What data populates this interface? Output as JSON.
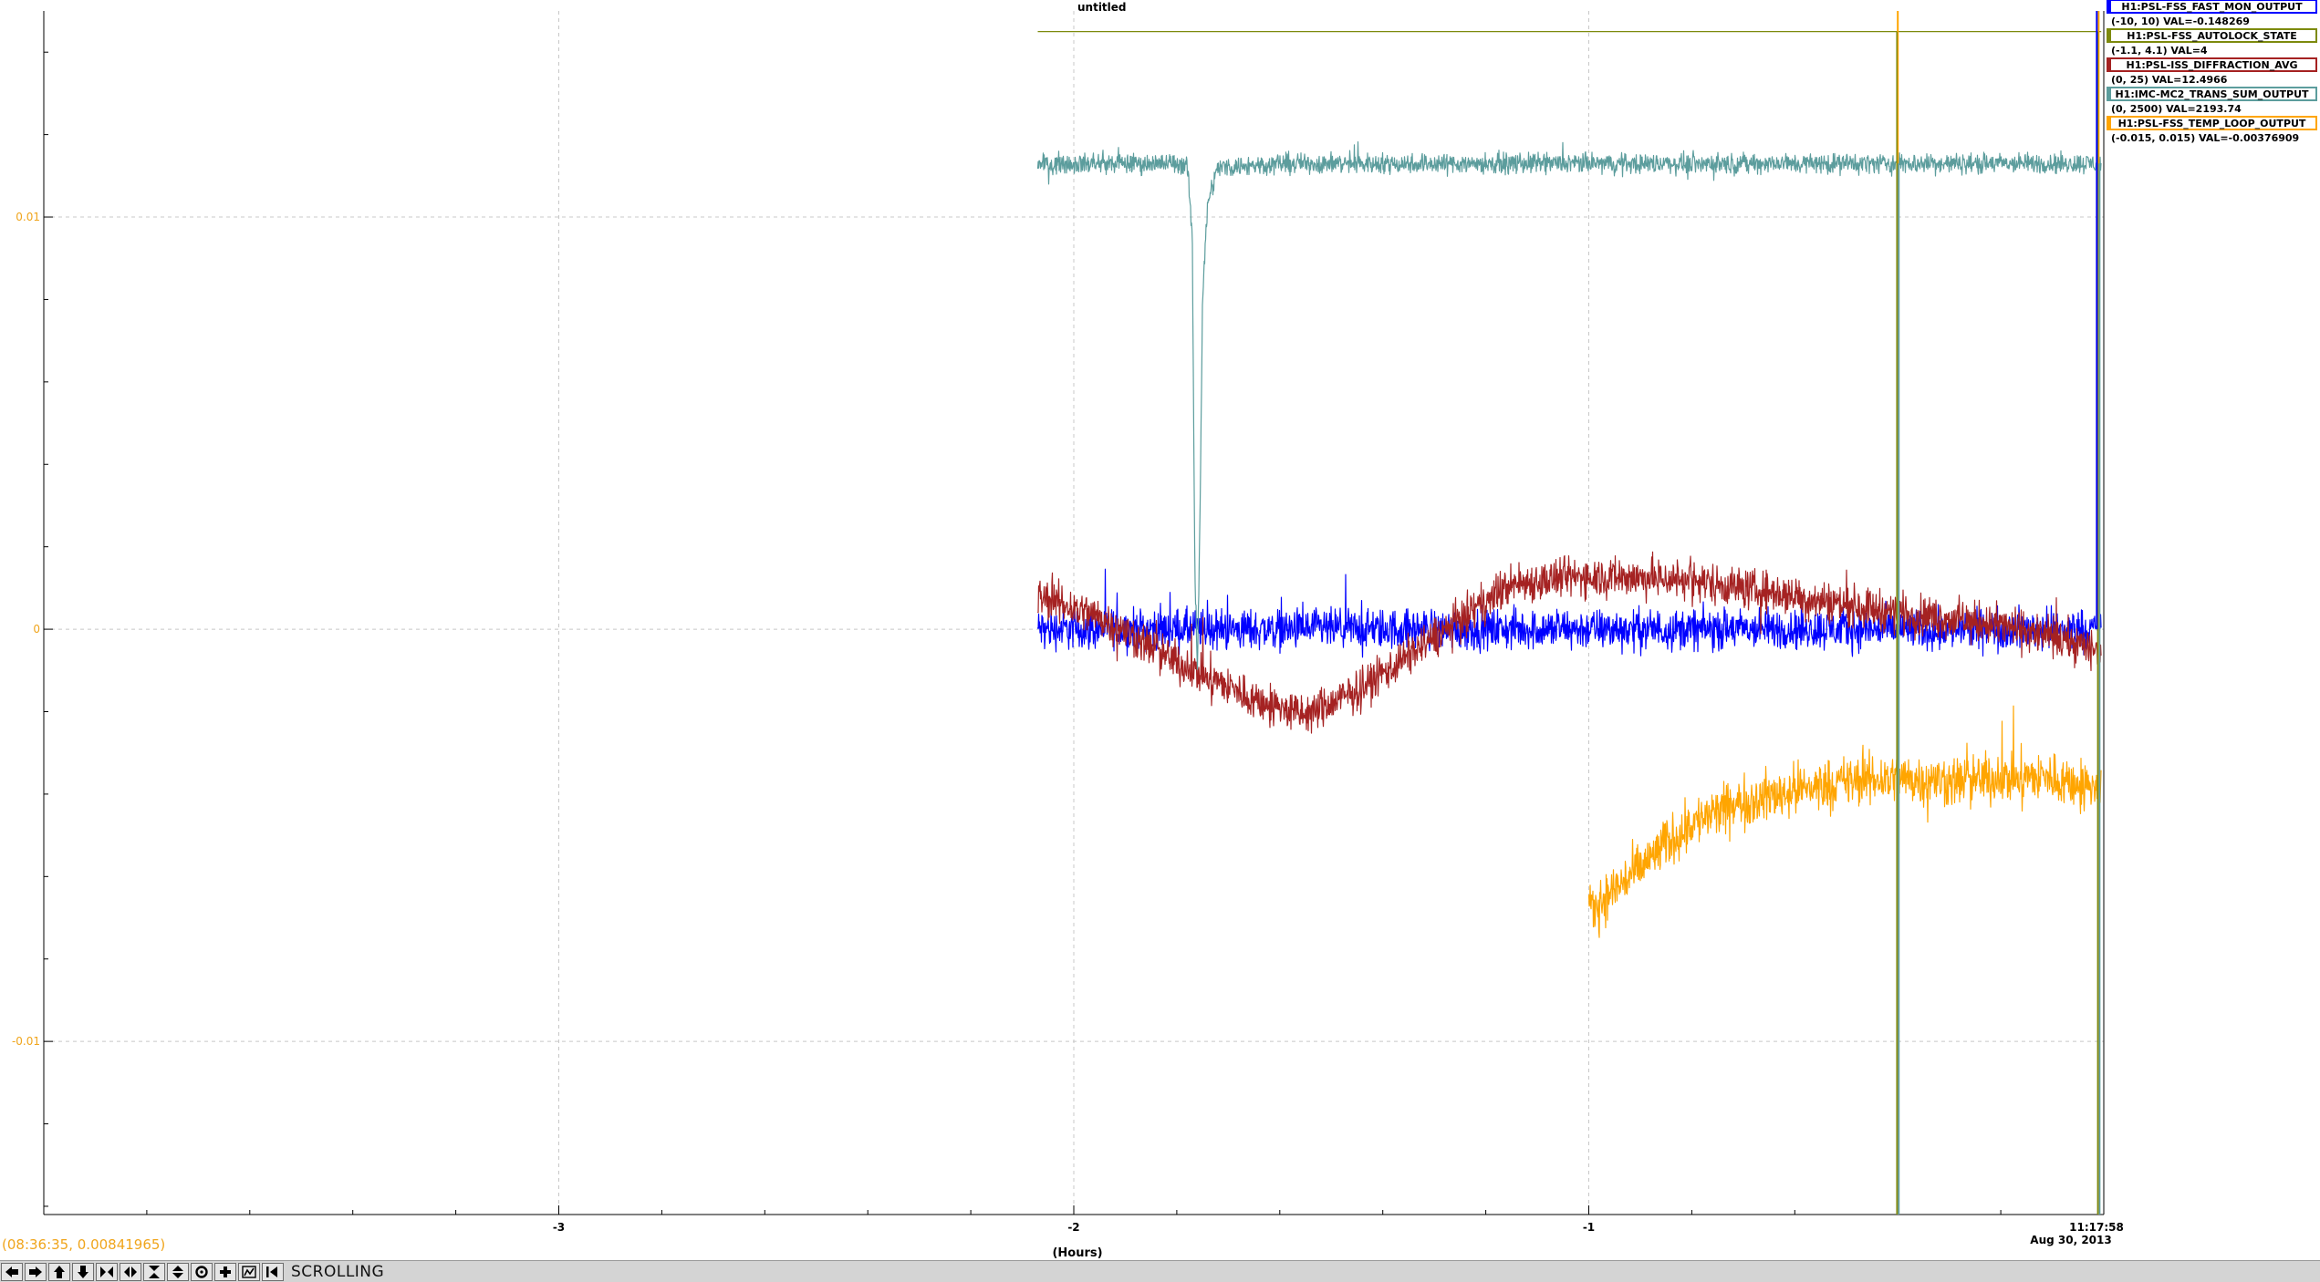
{
  "chart_data": {
    "type": "line",
    "title": "untitled",
    "xlabel": "(Hours)",
    "x_ticks": [
      -3,
      -2,
      -1
    ],
    "x_tick_labels": [
      "-3",
      "-2",
      "-1"
    ],
    "x_end_label": [
      "11:17:58",
      "Aug 30, 2013"
    ],
    "xlim": [
      -4.0,
      0.0
    ],
    "ylim": [
      -0.0142,
      0.015
    ],
    "y_ticks": [
      0.01,
      0,
      -0.01
    ],
    "y_tick_labels": [
      "0.01",
      "0",
      "-0.01"
    ],
    "y_tick_color": "#f0a51c",
    "grid": true,
    "legend_position": "top-right",
    "series": [
      {
        "name": "H1:PSL-FSS_FAST_MON_OUTPUT",
        "range_label": "(-10, 10) VAL=-0.148269",
        "color": "#0000ff",
        "x": [
          -2.07,
          -1.8,
          -1.5,
          -1.2,
          -0.9,
          -0.6,
          -0.3,
          -0.005
        ],
        "y": [
          0.0,
          0.0,
          0.0,
          0.0,
          0.0,
          0.0,
          0.0,
          0.0
        ],
        "noise": 0.0004
      },
      {
        "name": "H1:PSL-FSS_AUTOLOCK_STATE",
        "range_label": "(-1.1, 4.1) VAL=4",
        "color": "#7d8a0d",
        "x": [
          -2.07,
          -0.005
        ],
        "y": [
          0.0145,
          0.0145
        ],
        "noise": 0
      },
      {
        "name": "H1:PSL-ISS_DIFFRACTION_AVG",
        "range_label": "(0, 25) VAL=12.4966",
        "color": "#a52222",
        "x": [
          -2.07,
          -1.95,
          -1.8,
          -1.65,
          -1.55,
          -1.45,
          -1.3,
          -1.15,
          -1.0,
          -0.8,
          -0.6,
          -0.4,
          -0.2,
          -0.005
        ],
        "y": [
          0.0008,
          0.0003,
          -0.0008,
          -0.0017,
          -0.0021,
          -0.0015,
          -0.0002,
          0.0011,
          0.0013,
          0.0012,
          0.0008,
          0.0004,
          0.0001,
          -0.0005
        ],
        "noise": 0.0004
      },
      {
        "name": "H1:IMC-MC2_TRANS_SUM_OUTPUT",
        "range_label": "(0, 2500) VAL=2193.74",
        "color": "#5c9d9d",
        "x": [
          -2.07,
          -1.78,
          -1.77,
          -1.765,
          -1.76,
          -1.755,
          -1.75,
          -1.74,
          -1.72,
          -1.6,
          -1.0,
          -0.6,
          -0.2,
          -0.005
        ],
        "y": [
          0.0113,
          0.0113,
          0.0095,
          0.0015,
          -0.0009,
          0.0028,
          0.008,
          0.0104,
          0.0112,
          0.0113,
          0.0113,
          0.0113,
          0.0113,
          0.0113
        ],
        "noise": 0.0002
      },
      {
        "name": "H1:PSL-FSS_TEMP_LOOP_OUTPUT",
        "range_label": "(-0.015, 0.015) VAL=-0.00376909",
        "color": "#ffa500",
        "x": [
          -1.0,
          -0.95,
          -0.9,
          -0.85,
          -0.8,
          -0.7,
          -0.6,
          -0.5,
          -0.4,
          -0.3,
          -0.2,
          -0.1,
          -0.005
        ],
        "y": [
          -0.0069,
          -0.0063,
          -0.0058,
          -0.0052,
          -0.0047,
          -0.0042,
          -0.0039,
          -0.0037,
          -0.0036,
          -0.0037,
          -0.0036,
          -0.0036,
          -0.0039
        ],
        "noise": 0.0005
      }
    ]
  },
  "cursor_readout": "(08:36:35, 0.00841965)",
  "toolbar": {
    "mode_label": "SCROLLING",
    "buttons": [
      "scroll-left-icon",
      "scroll-right-icon",
      "scroll-up-icon",
      "scroll-down-icon",
      "compress-horizontal-icon",
      "expand-horizontal-icon",
      "compress-vertical-icon",
      "expand-vertical-icon",
      "zoom-out-icon",
      "zoom-in-icon",
      "auto-scale-icon",
      "back-icon"
    ]
  }
}
